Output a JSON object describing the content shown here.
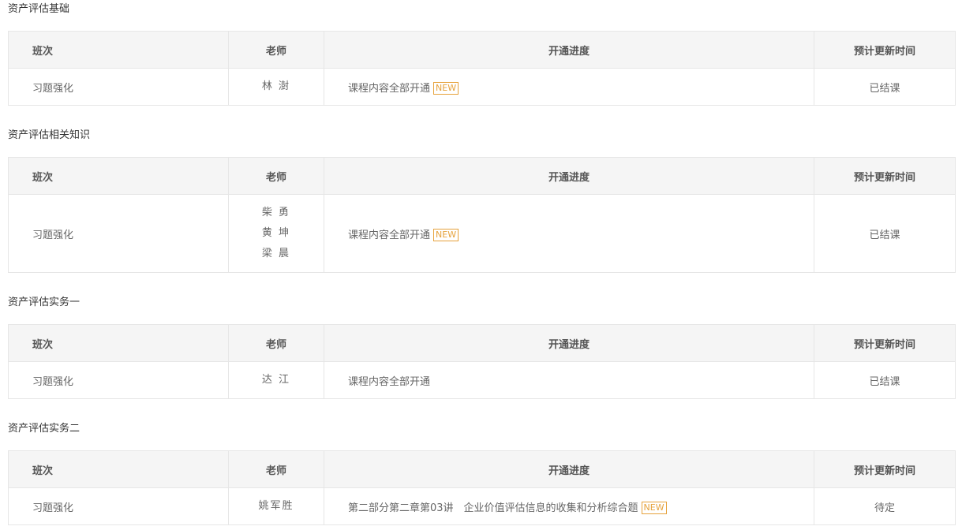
{
  "headers": {
    "class": "班次",
    "teacher": "老师",
    "progress": "开通进度",
    "update_time": "预计更新时间"
  },
  "sections": [
    {
      "title": "资产评估基础",
      "row": {
        "class": "习题强化",
        "teachers": [
          "林 澍"
        ],
        "progress": "课程内容全部开通",
        "badge": "NEW",
        "update_time": "已结课"
      }
    },
    {
      "title": "资产评估相关知识",
      "row": {
        "class": "习题强化",
        "teachers": [
          "柴 勇",
          "黄 坤",
          "梁 晨"
        ],
        "progress": "课程内容全部开通",
        "badge": "NEW",
        "update_time": "已结课"
      }
    },
    {
      "title": "资产评估实务一",
      "row": {
        "class": "习题强化",
        "teachers": [
          "达 江"
        ],
        "progress": "课程内容全部开通",
        "badge": "",
        "update_time": "已结课"
      }
    },
    {
      "title": "资产评估实务二",
      "row": {
        "class": "习题强化",
        "teachers": [
          "姚军胜"
        ],
        "progress": "第二部分第二章第03讲　企业价值评估信息的收集和分析综合题",
        "badge": "NEW",
        "update_time": "待定"
      }
    }
  ]
}
